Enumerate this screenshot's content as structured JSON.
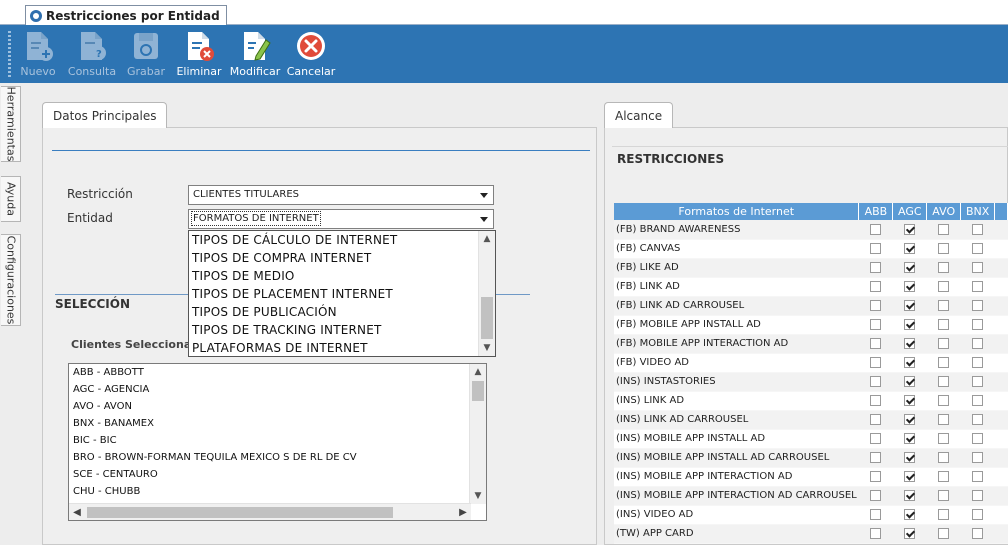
{
  "window": {
    "tab_title": "Restricciones por Entidad"
  },
  "toolbar": {
    "nuevo": "Nuevo",
    "consulta": "Consulta",
    "grabar": "Grabar",
    "eliminar": "Eliminar",
    "modificar": "Modificar",
    "cancelar": "Cancelar"
  },
  "side_tabs": {
    "herramientas": "Herramientas",
    "ayuda": "Ayuda",
    "configuraciones": "Configuraciones"
  },
  "datos": {
    "tab": "Datos Principales",
    "restriccion_label": "Restricción",
    "restriccion_value": "CLIENTES TITULARES",
    "entidad_label": "Entidad",
    "entidad_value": "FORMATOS DE INTERNET",
    "dropdown_options": [
      "TIPOS DE CÁLCULO DE INTERNET",
      "TIPOS DE COMPRA INTERNET",
      "TIPOS DE MEDIO",
      "TIPOS DE PLACEMENT INTERNET",
      "TIPOS DE PUBLICACIÓN",
      "TIPOS DE TRACKING INTERNET",
      "PLATAFORMAS DE INTERNET"
    ],
    "seleccion_title": "SELECCIÓN",
    "clientes_label": "Clientes Seleccionados",
    "clientes": [
      "ABB - ABBOTT",
      "AGC - AGENCIA",
      "AVO - AVON",
      "BNX - BANAMEX",
      "BIC - BIC",
      "BRO - BROWN-FORMAN TEQUILA MEXICO S DE RL DE CV",
      "SCE - CENTAURO",
      "CHU - CHUBB"
    ]
  },
  "alcance": {
    "tab": "Alcance",
    "title": "RESTRICCIONES",
    "grid_header": "Formatos de Internet",
    "columns": [
      "ABB",
      "AGC",
      "AVO",
      "BNX"
    ],
    "rows": [
      {
        "name": "(FB) BRAND AWARENESS",
        "checks": [
          false,
          true,
          false,
          false
        ]
      },
      {
        "name": "(FB) CANVAS",
        "checks": [
          false,
          true,
          false,
          false
        ]
      },
      {
        "name": "(FB) LIKE AD",
        "checks": [
          false,
          true,
          false,
          false
        ]
      },
      {
        "name": "(FB) LINK AD",
        "checks": [
          false,
          true,
          false,
          false
        ]
      },
      {
        "name": "(FB) LINK AD CARROUSEL",
        "checks": [
          false,
          true,
          false,
          false
        ]
      },
      {
        "name": "(FB) MOBILE APP INSTALL AD",
        "checks": [
          false,
          true,
          false,
          false
        ]
      },
      {
        "name": "(FB) MOBILE APP INTERACTION AD",
        "checks": [
          false,
          true,
          false,
          false
        ]
      },
      {
        "name": "(FB) VIDEO AD",
        "checks": [
          false,
          true,
          false,
          false
        ]
      },
      {
        "name": "(INS) INSTASTORIES",
        "checks": [
          false,
          true,
          false,
          false
        ]
      },
      {
        "name": "(INS) LINK AD",
        "checks": [
          false,
          true,
          false,
          false
        ]
      },
      {
        "name": "(INS) LINK AD CARROUSEL",
        "checks": [
          false,
          true,
          false,
          false
        ]
      },
      {
        "name": "(INS) MOBILE APP INSTALL AD",
        "checks": [
          false,
          true,
          false,
          false
        ]
      },
      {
        "name": "(INS) MOBILE APP INSTALL AD CARROUSEL",
        "checks": [
          false,
          true,
          false,
          false
        ]
      },
      {
        "name": "(INS) MOBILE APP INTERACTION AD",
        "checks": [
          false,
          true,
          false,
          false
        ]
      },
      {
        "name": "(INS) MOBILE APP INTERACTION AD CARROUSEL",
        "checks": [
          false,
          true,
          false,
          false
        ]
      },
      {
        "name": "(INS) VIDEO AD",
        "checks": [
          false,
          true,
          false,
          false
        ]
      },
      {
        "name": "(TW) APP CARD",
        "checks": [
          false,
          true,
          false,
          false
        ]
      }
    ]
  },
  "colors": {
    "toolbar": "#2d74b3",
    "grid_header": "#5b9bd5",
    "accent_rule": "#3a7ec0"
  }
}
